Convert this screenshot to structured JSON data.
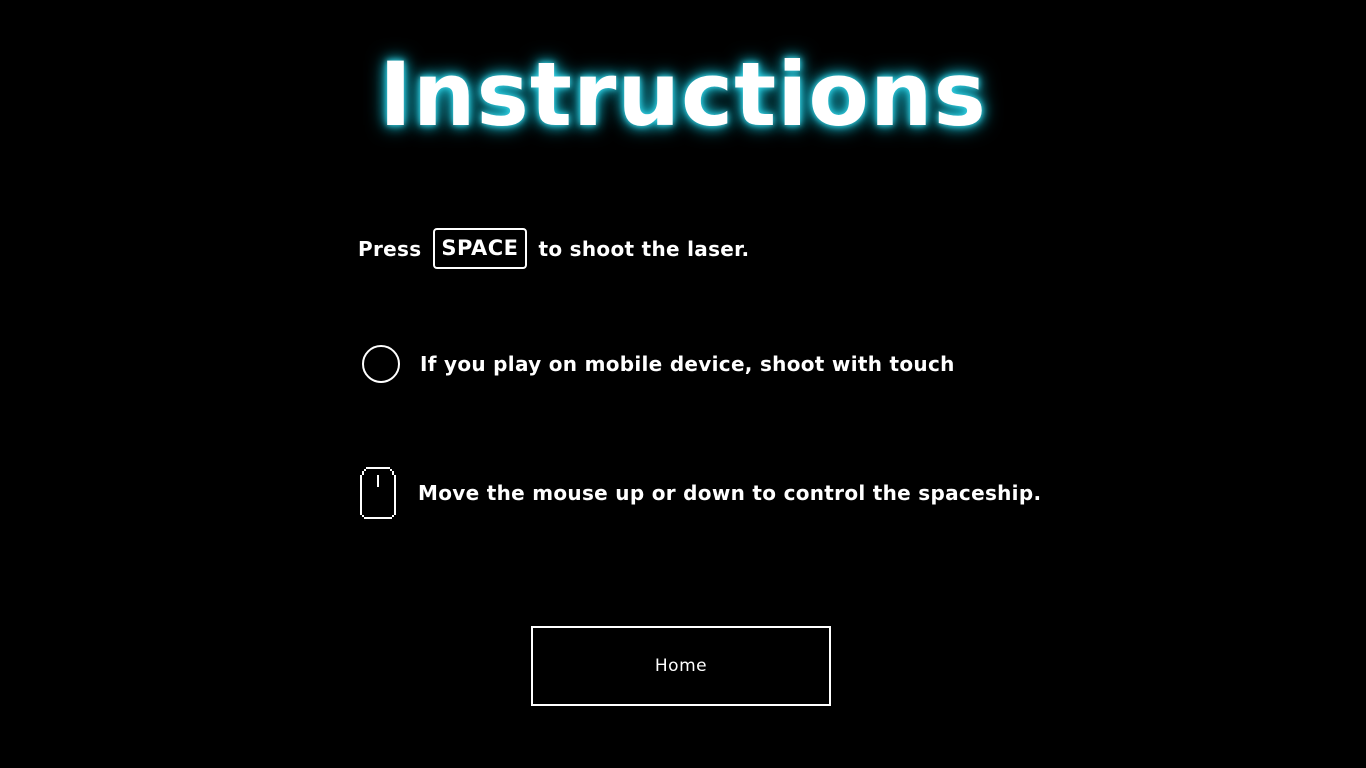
{
  "title": "Instructions",
  "instructions": {
    "space": {
      "before": "Press",
      "key": "SPACE",
      "after": "to shoot the laser."
    },
    "touch": {
      "icon": "touch-circle-icon",
      "text": "If you play on mobile device, shoot with touch"
    },
    "mouse": {
      "icon": "mouse-icon",
      "text": "Move the mouse up or down to control the spaceship."
    }
  },
  "home_button": {
    "label": "Home"
  },
  "colors": {
    "background": "#000000",
    "text": "#ffffff",
    "title_glow": "#1cc3d8"
  }
}
